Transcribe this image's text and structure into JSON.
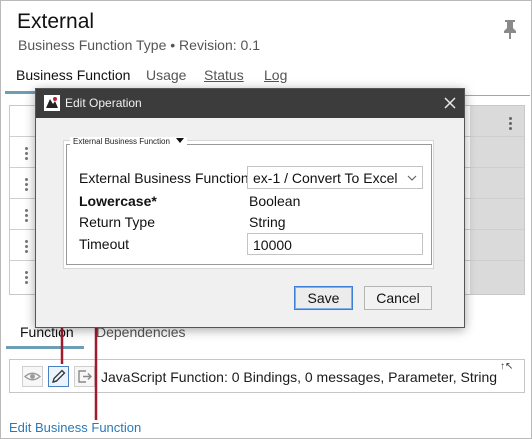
{
  "header": {
    "title": "External",
    "subtitle": "Business Function Type • Revision: 0.1"
  },
  "tabs": [
    {
      "label": "Business Function"
    },
    {
      "label": "Usage"
    },
    {
      "label": "Status"
    },
    {
      "label": "Log"
    }
  ],
  "bottom_tabs": [
    {
      "label": "Function"
    },
    {
      "label": "Dependencies"
    }
  ],
  "function_bar": {
    "summary": "JavaScript Function: 0 Bindings, 0 messages, Parameter, String",
    "expand_glyph": "↑↖"
  },
  "edit_link": "Edit Business Function",
  "dialog": {
    "title": "Edit Operation",
    "group_label": "External Business Function",
    "rows": [
      {
        "label": "External Business Function",
        "value": "ex-1 / Convert To Excel"
      },
      {
        "label": "Lowercase*",
        "value": "Boolean"
      },
      {
        "label": "Return Type",
        "value": "String"
      },
      {
        "label": "Timeout",
        "value": "10000"
      }
    ],
    "save_label": "Save",
    "cancel_label": "Cancel"
  },
  "colors": {
    "accent": "#6d9eb5",
    "link": "#2a79b6",
    "arrow": "#a01c2c",
    "dialog_title_bar": "#3c3c3c"
  }
}
